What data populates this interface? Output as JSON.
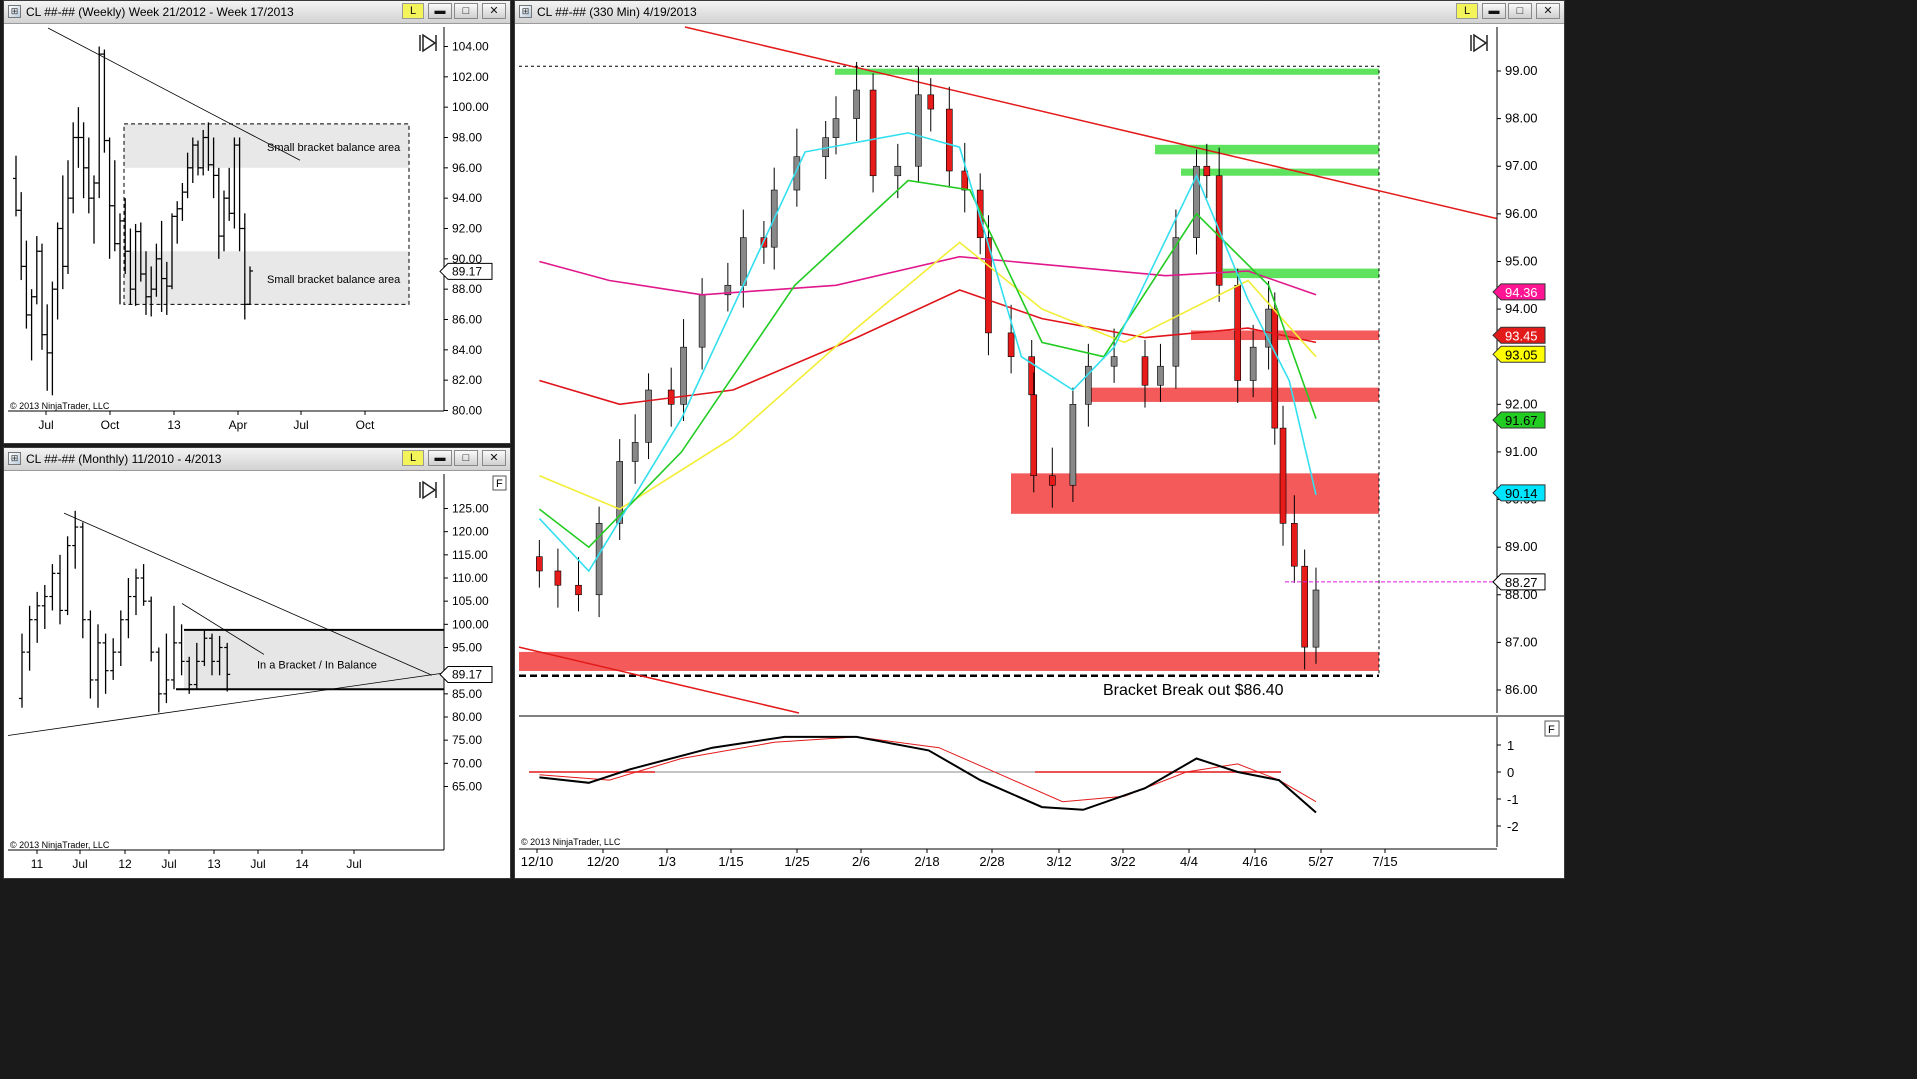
{
  "windows": {
    "weekly": {
      "title": "CL ##-## (Weekly)  Week 21/2012 - Week 17/2013",
      "link_label": "L",
      "min_label": "▬",
      "max_label": "□",
      "close_label": "✕"
    },
    "monthly": {
      "title": "CL ##-## (Monthly)  11/2010 - 4/2013",
      "link_label": "L",
      "min_label": "▬",
      "max_label": "□",
      "close_label": "✕"
    },
    "intraday": {
      "title": "CL ##-## (330 Min)  4/19/2013",
      "link_label": "L",
      "min_label": "▬",
      "max_label": "□",
      "close_label": "✕"
    }
  },
  "copyright": "© 2013 NinjaTrader, LLC",
  "f_button_label": "F",
  "chart_data": [
    {
      "id": "weekly",
      "type": "ohlc",
      "title": "CL ##-## (Weekly)  Week 21/2012 - Week 17/2013",
      "ylim": [
        79.5,
        105.5
      ],
      "yticks": [
        "104.00",
        "102.00",
        "100.00",
        "98.00",
        "96.00",
        "94.00",
        "92.00",
        "90.00",
        "88.00",
        "86.00",
        "84.00",
        "82.00",
        "80.00"
      ],
      "xticks": [
        "Jul",
        "Oct",
        "13",
        "Apr",
        "Jul",
        "Oct"
      ],
      "last_price": "89.17",
      "annotations": [
        "Small bracket balance area",
        "Small bracket balance area"
      ],
      "bars": [
        [
          95.3,
          96.8,
          92.8,
          93.2
        ],
        [
          93.2,
          94.4,
          88.6,
          89.5
        ],
        [
          89.5,
          91.2,
          85.4,
          86.3
        ],
        [
          86.3,
          88.0,
          83.3,
          87.5
        ],
        [
          87.5,
          91.5,
          87.0,
          90.5
        ],
        [
          90.5,
          91.0,
          84.0,
          85.0
        ],
        [
          85.0,
          87.0,
          81.3,
          83.8
        ],
        [
          83.8,
          88.5,
          81.0,
          88.0
        ],
        [
          88.0,
          92.4,
          86.0,
          92.0
        ],
        [
          92.0,
          95.5,
          88.0,
          89.5
        ],
        [
          89.5,
          96.5,
          89.0,
          94.0
        ],
        [
          94.0,
          99.0,
          93.0,
          98.0
        ],
        [
          98.0,
          100.0,
          96.0,
          98.0
        ],
        [
          98.0,
          99.0,
          94.0,
          96.0
        ],
        [
          96.0,
          98.0,
          93.0,
          94.0
        ],
        [
          94.0,
          95.5,
          91.0,
          95.0
        ],
        [
          95.0,
          104.0,
          94.0,
          103.5
        ],
        [
          103.5,
          103.8,
          97.0,
          97.8
        ],
        [
          97.8,
          98.0,
          90.0,
          93.5
        ],
        [
          93.5,
          96.5,
          90.5,
          91.0
        ],
        [
          91.0,
          93.0,
          87.0,
          92.5
        ],
        [
          92.5,
          94.0,
          89.0,
          90.5
        ],
        [
          90.5,
          92.0,
          87.0,
          88.0
        ],
        [
          88.0,
          92.3,
          86.9,
          91.8
        ],
        [
          91.8,
          92.4,
          88.5,
          89.0
        ],
        [
          89.0,
          90.5,
          86.3,
          87.5
        ],
        [
          87.5,
          89.5,
          86.2,
          88.0
        ],
        [
          88.0,
          91.0,
          87.5,
          90.0
        ],
        [
          90.0,
          92.5,
          86.5,
          88.7
        ],
        [
          88.7,
          89.8,
          86.3,
          88.2
        ],
        [
          88.2,
          93.0,
          88.0,
          92.8
        ],
        [
          92.8,
          93.8,
          91.0,
          93.3
        ],
        [
          93.3,
          95.0,
          92.5,
          94.4
        ],
        [
          94.4,
          97.0,
          94.0,
          96.0
        ],
        [
          96.0,
          98.0,
          95.0,
          97.5
        ],
        [
          97.5,
          97.8,
          95.5,
          96.0
        ],
        [
          96.0,
          98.5,
          95.5,
          98.0
        ],
        [
          98.0,
          99.0,
          95.8,
          96.2
        ],
        [
          96.2,
          98.0,
          94.0,
          95.5
        ],
        [
          95.5,
          96.0,
          90.0,
          91.5
        ],
        [
          91.5,
          94.5,
          90.5,
          94.0
        ],
        [
          94.0,
          96.0,
          92.5,
          93.0
        ],
        [
          93.0,
          98.0,
          92.0,
          97.5
        ],
        [
          97.5,
          98.0,
          90.5,
          92.0
        ],
        [
          92.0,
          93.0,
          86.0,
          87.0
        ],
        [
          87.0,
          89.5,
          87.0,
          89.2
        ]
      ]
    },
    {
      "id": "monthly",
      "type": "ohlc",
      "title": "CL ##-## (Monthly)  11/2010 - 4/2013",
      "ylim": [
        60,
        130
      ],
      "yticks": [
        "125.00",
        "120.00",
        "115.00",
        "110.00",
        "105.00",
        "100.00",
        "95.00",
        "90.00",
        "85.00",
        "80.00",
        "75.00",
        "70.00",
        "65.00"
      ],
      "xticks": [
        "11",
        "Jul",
        "12",
        "Jul",
        "13",
        "Jul",
        "14",
        "Jul"
      ],
      "last_price": "89.17",
      "annotations": [
        "In a Bracket / In Balance"
      ],
      "bars": [
        [
          84.0,
          98.0,
          82.0,
          94.0
        ],
        [
          94.0,
          104.0,
          90.0,
          101.0
        ],
        [
          101.0,
          107.0,
          96.0,
          104.0
        ],
        [
          104.0,
          108.5,
          99.0,
          106.0
        ],
        [
          106.0,
          113.0,
          103.0,
          111.0
        ],
        [
          111.0,
          115.0,
          100.0,
          103.0
        ],
        [
          103.0,
          119.0,
          102.0,
          117.0
        ],
        [
          117.0,
          124.5,
          112.0,
          121.0
        ],
        [
          121.0,
          122.0,
          97.0,
          101.0
        ],
        [
          101.0,
          103.0,
          84.0,
          88.0
        ],
        [
          88.0,
          100.0,
          82.0,
          96.0
        ],
        [
          96.0,
          98.0,
          85.0,
          90.0
        ],
        [
          90.0,
          97.0,
          88.0,
          94.0
        ],
        [
          94.0,
          103.0,
          91.0,
          101.0
        ],
        [
          101.0,
          110.0,
          97.0,
          106.0
        ],
        [
          106.0,
          112.0,
          102.0,
          110.0
        ],
        [
          110.0,
          113.0,
          104.0,
          105.0
        ],
        [
          105.0,
          106.0,
          92.0,
          94.0
        ],
        [
          94.0,
          95.0,
          81.0,
          85.0
        ],
        [
          85.0,
          98.0,
          83.0,
          88.0
        ],
        [
          88.0,
          104.0,
          86.0,
          96.0
        ],
        [
          96.0,
          100.0,
          89.0,
          92.0
        ],
        [
          92.0,
          93.0,
          85.0,
          87.0
        ],
        [
          87.0,
          96.0,
          86.0,
          92.0
        ],
        [
          92.0,
          99.0,
          91.0,
          97.0
        ],
        [
          97.0,
          98.0,
          89.0,
          92.0
        ],
        [
          92.0,
          97.5,
          89.0,
          95.0
        ],
        [
          95.0,
          96.0,
          85.5,
          89.2
        ]
      ]
    },
    {
      "id": "intraday",
      "type": "candlestick",
      "title": "CL ##-## (330 Min)  4/19/2013",
      "ylim": [
        85.5,
        100.0
      ],
      "yticks": [
        "99.00",
        "98.00",
        "97.00",
        "96.00",
        "95.00",
        "94.00",
        "93.00",
        "92.00",
        "91.00",
        "90.00",
        "89.00",
        "88.00",
        "87.00",
        "86.00"
      ],
      "xticks": [
        "12/10",
        "12/20",
        "1/3",
        "1/15",
        "1/25",
        "2/6",
        "2/18",
        "2/28",
        "3/12",
        "3/22",
        "4/4",
        "4/16",
        "5/27",
        "7/15"
      ],
      "annotations": [
        "Bracket Break out $86.40"
      ],
      "price_labels": [
        {
          "text": "94.36",
          "color": "#ff1493"
        },
        {
          "text": "93.45",
          "color": "#e31a1a"
        },
        {
          "text": "93.05",
          "color": "#ffff00"
        },
        {
          "text": "91.67",
          "color": "#22cc22"
        },
        {
          "text": "90.14",
          "color": "#00e5ff"
        },
        {
          "text": "88.27",
          "color": "#ffffff"
        }
      ],
      "oscillator": {
        "yticks": [
          "1",
          "0",
          "-1",
          "-2"
        ],
        "ylim": [
          -2.6,
          1.6
        ]
      },
      "colors": {
        "up": "#888888",
        "down": "#e81b1b",
        "ema_fast": "#33dfef",
        "ema_med": "#22cc22",
        "ema_slow": "#f2ee35",
        "ma_red": "#e0141a",
        "ma_magenta": "#e0188c",
        "supply": "#f45a5a",
        "demand": "#5fe35f"
      }
    }
  ]
}
